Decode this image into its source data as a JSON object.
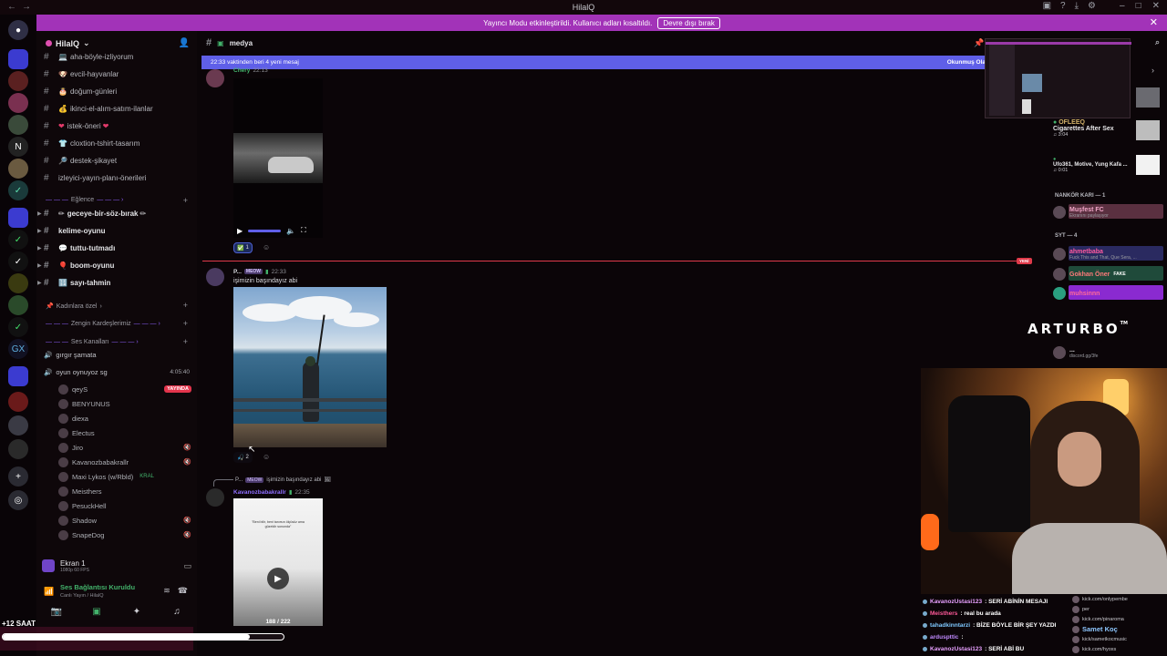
{
  "titlebar": {
    "title": "HilalQ"
  },
  "banner": {
    "text": "Yayıncı Modu etkinleştirildi. Kullanıcı adları kısaltıldı.",
    "button": "Devre dışı bırak"
  },
  "guild": {
    "name": "HilalQ"
  },
  "channels": [
    {
      "emoji": "💻",
      "label": "aha-böyle-izliyorum"
    },
    {
      "emoji": "🐶",
      "label": "evcil-hayvanlar"
    },
    {
      "emoji": "🎂",
      "label": "doğum-günleri"
    },
    {
      "emoji": "💰",
      "label": "ikinci-el-alım-satım-ilanlar"
    },
    {
      "emoji": "❤",
      "label": "istek-öneri",
      "suffix": "❤"
    },
    {
      "emoji": "👕",
      "label": "cloxtion-tshirt-tasarım"
    },
    {
      "emoji": "🔎",
      "label": "destek-şikayet"
    },
    {
      "emoji": "",
      "label": "izleyici-yayın-planı-önerileri"
    }
  ],
  "category_eglence": "Eğlence",
  "fun_channels": [
    {
      "emoji": "✏",
      "label": "geceye-bir-söz-bırak",
      "suffix": "✏"
    },
    {
      "emoji": "",
      "label": "kelime-oyunu"
    },
    {
      "emoji": "💬",
      "label": "tuttu-tutmadı"
    },
    {
      "emoji": "🎈",
      "label": "boom-oyunu"
    },
    {
      "emoji": "🔢",
      "label": "sayı-tahmin"
    }
  ],
  "category_kadinlara": "Kadınlara özel",
  "category_zengin": "Zengin Kardeşlerimiz",
  "category_ses": "Ses Kanalları",
  "voice_channels": [
    {
      "label": "gırgır şamata",
      "emoji": "🔊"
    },
    {
      "label": "oyun oynuyoz sg",
      "emoji": "🔊",
      "timer": "4:05:40"
    }
  ],
  "voice_users": [
    {
      "name": "qeyS",
      "badge": "YAYINDA"
    },
    {
      "name": "BENYUNUS"
    },
    {
      "name": "diexa"
    },
    {
      "name": "Electus"
    },
    {
      "name": "Jiro"
    },
    {
      "name": "Kavanozbabakrallr"
    },
    {
      "name": "Maxi Lykos (w/Rbld)",
      "extra": "KRAL"
    },
    {
      "name": "Meisthers"
    },
    {
      "name": "PesuckHell"
    },
    {
      "name": "Shadow"
    },
    {
      "name": "SnapeDog"
    }
  ],
  "screen_panel": {
    "title": "Ekran 1",
    "sub": "1080p 60 FPS"
  },
  "voice_panel": {
    "title": "Ses Bağlantısı Kuruldu",
    "sub": "Canlı Yayın / HilalQ"
  },
  "overlay": {
    "saat": "+12 SAAT",
    "progress": 0.88
  },
  "chat": {
    "channel": "medya",
    "new_bar": "22:33 vaktinden beri 4 yeni mesaj",
    "new_bar_right": "Okunmuş Ola",
    "new_badge": "YENİ",
    "msg1": {
      "name": "Chery",
      "time": "22:13",
      "reaction_count": "1"
    },
    "msg2": {
      "name": "P...",
      "tag": "MEOW",
      "time": "22:33",
      "text": "işimizin başındayız abi",
      "reaction_count": "2"
    },
    "msg3": {
      "reply_name": "P...",
      "reply_tag": "MEOW",
      "reply_text": "işimizin başındayız abi",
      "name": "Kavanozbabakrallr",
      "time": "22:35",
      "video_counter": "188 / 222",
      "caption": "\"Beni bilir, beni tanırsın ölçüsüz ama güzeldir sonunda\""
    }
  },
  "right_panel": {
    "np1_user": "OFLEEQ",
    "np1_title": "Cigarettes After Sex",
    "np1_time": "3:04",
    "np2_title": "Ufo361, Motive, Yung Kafa ...",
    "np2_time": "0:01",
    "sec1": "NANKÖR KARI — 1",
    "m1": {
      "name": "Muşfest FC",
      "sub": "Ekranını paylaşıyor"
    },
    "sec2": "SYT — 4",
    "m2": {
      "name": "ahmetbaba",
      "sub": "Fuck This and That, Que Sera, ..."
    },
    "m3": {
      "name": "Gokhan Öner",
      "sub": "FAKE"
    },
    "m4": {
      "name": "muhsinnn"
    },
    "m5": {
      "name": "...",
      "sub": "discord.gg/3fe"
    },
    "brand": "ARTURBO",
    "brand_tm": "TM"
  },
  "chatlog": [
    {
      "user": "KavanozUstasi123",
      "msg": ": SERİ ABİNİN MESAJI",
      "color": "#e8a0ff"
    },
    {
      "user": "Meisthers",
      "msg": ": real bu arada",
      "color": "#ff5a9a"
    },
    {
      "user": "tahadkinntarzi",
      "msg": ": BİZE BÖYLE BİR ŞEY YAZDI",
      "color": "#7ec8ff"
    },
    {
      "user": "arduspttic",
      "msg": ":",
      "color": "#c08aff"
    },
    {
      "user": "KavanozUstasi123",
      "msg": ": SERİ ABİ BU",
      "color": "#e8a0ff"
    }
  ],
  "chatlog_right": [
    {
      "text": "kick.com/onlypembe"
    },
    {
      "text": "per"
    },
    {
      "text": "kick.com/pinaroma"
    },
    {
      "text": "Samet Koç",
      "big": true
    },
    {
      "text": "kick/sametkocmusic"
    },
    {
      "text": "kick.com/hyoxs"
    }
  ]
}
